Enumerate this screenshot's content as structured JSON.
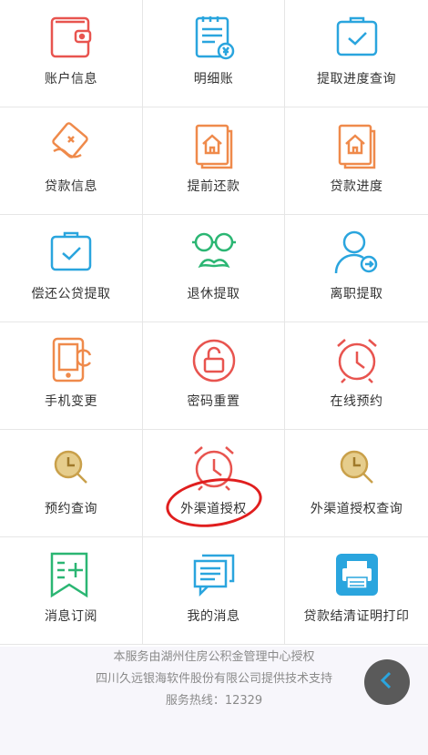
{
  "menu": [
    {
      "label": "账户信息",
      "icon": "wallet-icon"
    },
    {
      "label": "明细账",
      "icon": "ledger-icon"
    },
    {
      "label": "提取进度查询",
      "icon": "clipboard-check-icon"
    },
    {
      "label": "贷款信息",
      "icon": "loan-info-icon"
    },
    {
      "label": "提前还款",
      "icon": "house-document-icon"
    },
    {
      "label": "贷款进度",
      "icon": "house-document-icon"
    },
    {
      "label": "偿还公贷提取",
      "icon": "clipboard-check-icon"
    },
    {
      "label": "退休提取",
      "icon": "glasses-mustache-icon"
    },
    {
      "label": "离职提取",
      "icon": "user-exit-icon"
    },
    {
      "label": "手机变更",
      "icon": "phone-refresh-icon"
    },
    {
      "label": "密码重置",
      "icon": "unlock-icon"
    },
    {
      "label": "在线预约",
      "icon": "alarm-clock-icon"
    },
    {
      "label": "预约查询",
      "icon": "search-clock-icon"
    },
    {
      "label": "外渠道授权",
      "icon": "alarm-clock-icon"
    },
    {
      "label": "外渠道授权查询",
      "icon": "search-clock-icon"
    },
    {
      "label": "消息订阅",
      "icon": "subscribe-icon"
    },
    {
      "label": "我的消息",
      "icon": "messages-icon"
    },
    {
      "label": "贷款结清证明打印",
      "icon": "printer-icon"
    }
  ],
  "footer": {
    "line1": "本服务由湖州住房公积金管理中心授权",
    "line2": "四川久远银海软件股份有限公司提供技术支持",
    "line3": "服务热线：12329"
  },
  "colors": {
    "red": "#e8544f",
    "blue": "#2aa5de",
    "orange": "#ef8a4b",
    "green": "#2bb673",
    "gold": "#c9a04a"
  }
}
